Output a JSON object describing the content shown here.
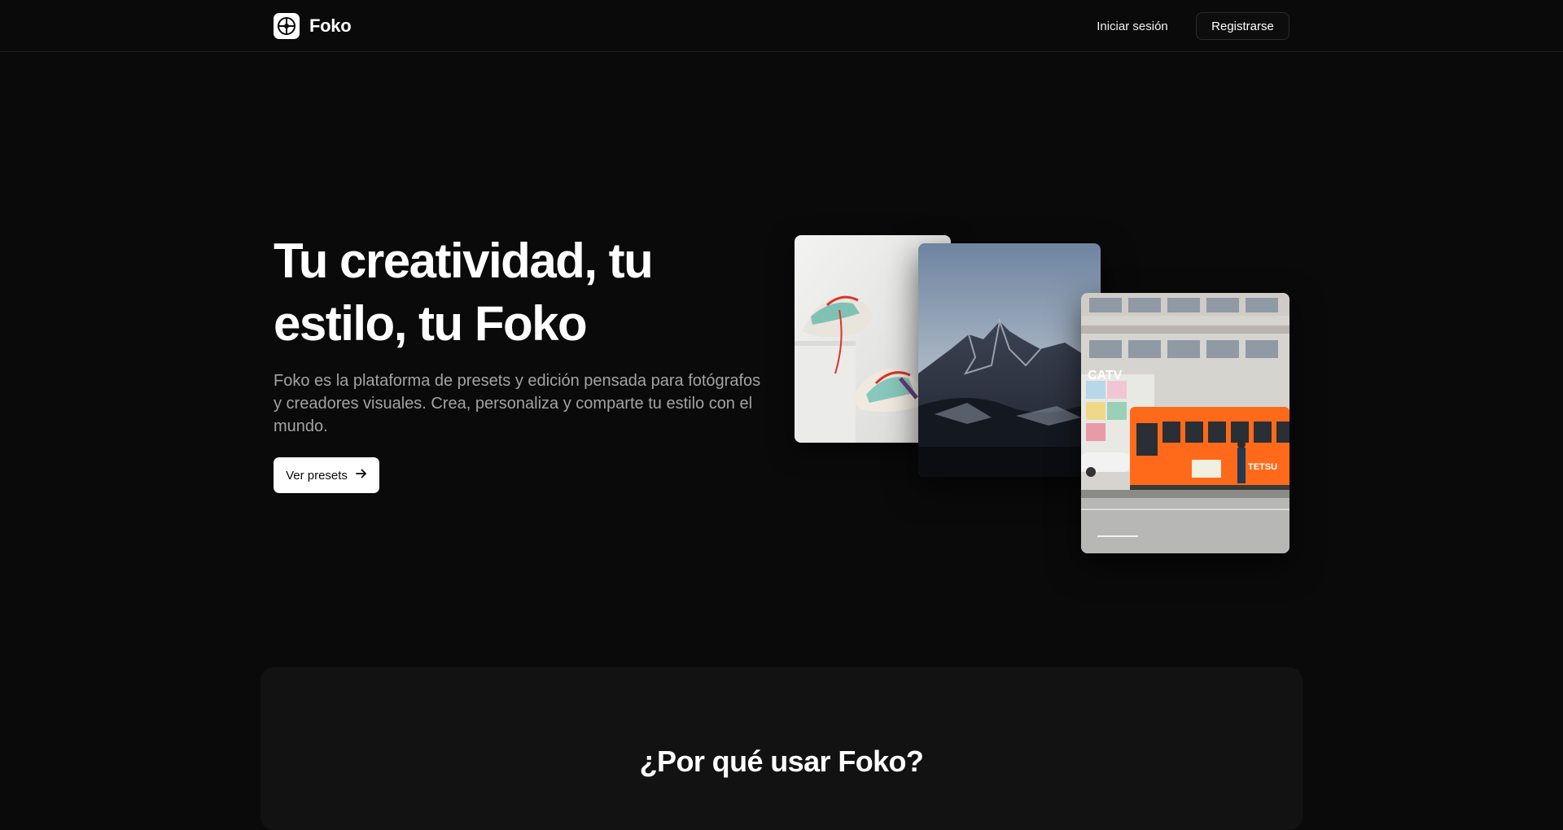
{
  "brand": {
    "name": "Foko",
    "logo_icon": "compass-icon"
  },
  "nav": {
    "login_label": "Iniciar sesión",
    "signup_label": "Registrarse"
  },
  "hero": {
    "title": "Tu creatividad, tu estilo, tu Foko",
    "description": "Foko es la plataforma de presets y edición pensada para fotógrafos y creadores visuales. Crea, personaliza y comparte tu estilo con el mundo.",
    "cta_label": "Ver presets",
    "cta_icon": "arrow-right-icon"
  },
  "gallery": [
    {
      "subject": "sneaker",
      "icon": "sneaker-photo"
    },
    {
      "subject": "mountain",
      "icon": "mountain-photo"
    },
    {
      "subject": "tram",
      "icon": "tram-photo",
      "sign_text": "TETSU",
      "building_sign": "CATV"
    }
  ],
  "why": {
    "title": "¿Por qué usar Foko?"
  },
  "colors": {
    "background": "#0a0a0a",
    "panel": "#121212",
    "accent": "#ff6a1a",
    "text_muted": "#a3a3a3"
  }
}
